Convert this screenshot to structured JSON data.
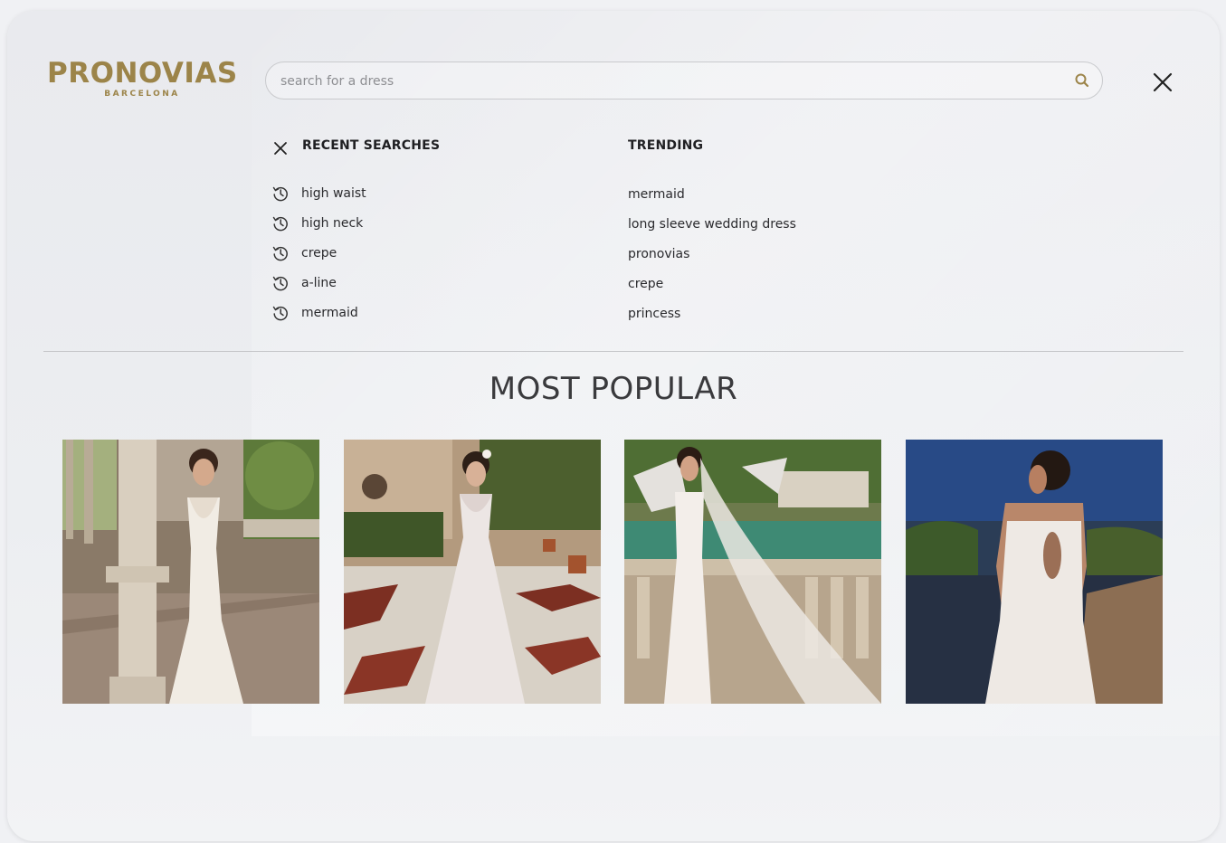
{
  "brand": {
    "name": "PRONOVIAS",
    "location": "BARCELONA",
    "color": "#9c8449"
  },
  "search": {
    "placeholder": "search for a dress",
    "value": "",
    "icon": "search-icon",
    "icon_color": "#9c8449"
  },
  "close": {
    "icon": "close-icon"
  },
  "recent": {
    "title": "RECENT SEARCHES",
    "clear_icon": "close-icon",
    "item_icon": "history-icon",
    "items": [
      {
        "label": "high waist"
      },
      {
        "label": "high neck"
      },
      {
        "label": "crepe"
      },
      {
        "label": "a-line"
      },
      {
        "label": "mermaid"
      }
    ]
  },
  "trending": {
    "title": "TRENDING",
    "items": [
      {
        "label": "mermaid"
      },
      {
        "label": "long sleeve wedding dress"
      },
      {
        "label": "pronovias"
      },
      {
        "label": "crepe"
      },
      {
        "label": "princess"
      }
    ]
  },
  "popular": {
    "title": "MOST POPULAR",
    "products": [
      {
        "image": "bride-mermaid-dress-columns-photo"
      },
      {
        "image": "bride-lace-gown-courtyard-photo"
      },
      {
        "image": "bride-veil-dress-garden-balustrade-photo"
      },
      {
        "image": "bride-backless-lace-dress-lake-photo"
      }
    ]
  }
}
